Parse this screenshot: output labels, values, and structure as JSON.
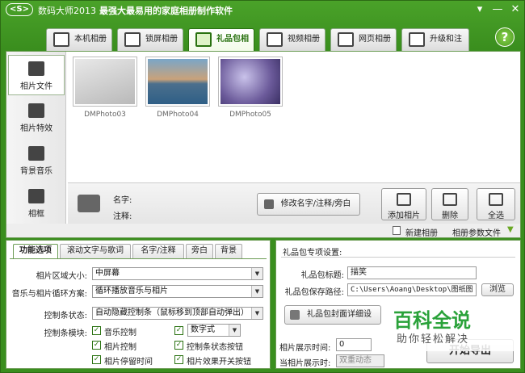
{
  "app": {
    "logo_text": "<S>",
    "title": "数码大师2013",
    "slogan": "最强大最易用的家庭相册制作软件"
  },
  "tabs": [
    {
      "label": "本机相册",
      "icon": "monitor-photo-icon",
      "active": false
    },
    {
      "label": "锁屏相册",
      "icon": "screen-icon",
      "active": false
    },
    {
      "label": "礼品包相册",
      "icon": "gift-icon",
      "active": true
    },
    {
      "label": "视频相册",
      "icon": "film-icon",
      "active": false
    },
    {
      "label": "网页相册",
      "icon": "ie-icon",
      "active": false
    },
    {
      "label": "升级和注册",
      "icon": "globe-icon",
      "active": false
    }
  ],
  "help_label": "?",
  "sidebar": [
    {
      "label": "相片文件",
      "icon": "camera-icon",
      "active": true
    },
    {
      "label": "相片特效",
      "icon": "effects-icon",
      "active": false
    },
    {
      "label": "背景音乐",
      "icon": "music-note-icon",
      "active": false
    },
    {
      "label": "相框",
      "icon": "frame-icon",
      "active": false
    }
  ],
  "photos": [
    {
      "name": "DMPhoto03",
      "color": "#cfcfcf"
    },
    {
      "name": "DMPhoto04",
      "color": "#2f5f86"
    },
    {
      "name": "DMPhoto05",
      "color": "#6b5a9a"
    }
  ],
  "info": {
    "name_label": "名字:",
    "note_label": "注释:",
    "edit_button": "修改名字/注释/旁白",
    "add_button": "添加相片",
    "delete_button": "删除",
    "select_all_button": "全选"
  },
  "bottombar": {
    "new_album": "新建相册",
    "params_file": "相册参数文件"
  },
  "left_panel": {
    "tabs": [
      "功能选项",
      "滚动文字与歌词",
      "名字/注释",
      "旁白",
      "背景"
    ],
    "area_size_label": "相片区域大小:",
    "area_size_value": "中屏幕",
    "loop_label": "音乐与相片循环方案:",
    "loop_value": "循环播放音乐与相片",
    "control_bar_label": "控制条状态:",
    "control_bar_value": "自动隐藏控制条（鼠标移到顶部自动弹出）",
    "module_label": "控制条模块:",
    "checks": [
      {
        "label": "音乐控制",
        "checked": true
      },
      {
        "label": "相片控制",
        "checked": true
      },
      {
        "label": "相片停留时间",
        "checked": true
      },
      {
        "label": "控制条状态按钮",
        "checked": true
      },
      {
        "label": "相片效果开关按钮",
        "checked": true
      }
    ],
    "digit_select": "数字式"
  },
  "right_panel": {
    "title": "礼品包专项设置:",
    "gift_title_label": "礼品包标题:",
    "gift_title_value": "描笑",
    "save_path_label": "礼品包保存路径:",
    "save_path_value": "C:\\Users\\Aoang\\Desktop\\图纸图",
    "browse_button": "浏览",
    "cover_button": "礼品包封面详细设",
    "show_time_label": "相片展示时间:",
    "show_time_value": "0",
    "show_when_label": "当相片展示时:",
    "show_when_value": "双重动态",
    "start_button": "开始导出"
  },
  "watermark": {
    "title": "百科全说",
    "subtitle": "助你轻松解决"
  }
}
